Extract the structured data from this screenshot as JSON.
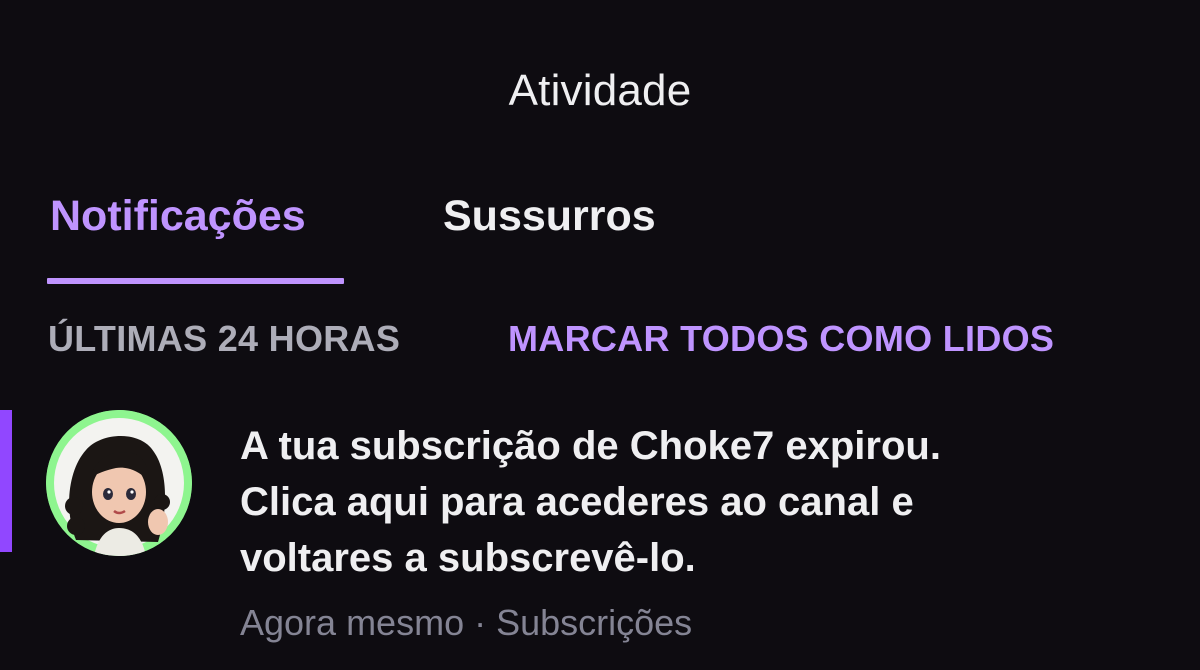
{
  "header": {
    "title": "Atividade"
  },
  "tabs": [
    {
      "label": "Notificações",
      "active": true
    },
    {
      "label": "Sussurros",
      "active": false
    }
  ],
  "section": {
    "label": "ÚLTIMAS 24 HORAS",
    "action_label": "MARCAR TODOS COMO LIDOS"
  },
  "notifications": [
    {
      "text_lines": [
        "A tua subscrição de Choke7 expirou.",
        "Clica aqui para acederes ao canal e",
        "voltares a subscrevê-lo."
      ],
      "time": "Agora mesmo",
      "separator": " · ",
      "category": "Subscrições",
      "unread": true,
      "avatar_icon": "user-avatar-illustration"
    }
  ],
  "colors": {
    "background": "#0e0c11",
    "accent": "#bf94ff",
    "unread_indicator": "#9147ff",
    "text_primary": "#efeff1",
    "text_secondary": "#adadb8",
    "text_muted": "#848494",
    "avatar_ring": "#8ef58f"
  }
}
